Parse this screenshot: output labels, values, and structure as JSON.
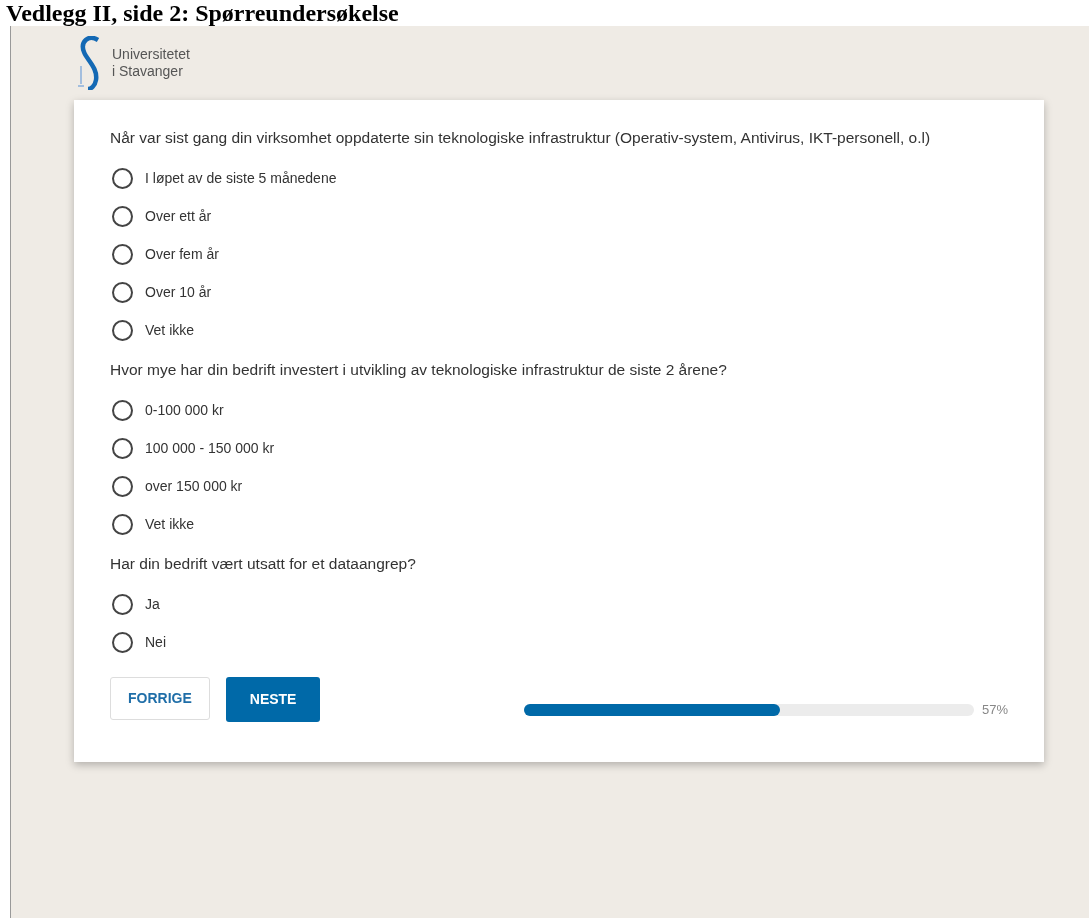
{
  "document_heading": "Vedlegg II, side 2: Spørreundersøkelse",
  "logo": {
    "lines": [
      "Universitetet",
      "i Stavanger"
    ]
  },
  "questions": [
    {
      "text": "Når var sist gang din virksomhet oppdaterte sin teknologiske infrastruktur (Operativ-system, Antivirus, IKT-personell, o.l)",
      "options": [
        {
          "label": "I løpet av de siste 5 månedene",
          "selected": false
        },
        {
          "label": "Over ett år",
          "selected": false
        },
        {
          "label": "Over fem år",
          "selected": false
        },
        {
          "label": "Over 10 år",
          "selected": false
        },
        {
          "label": "Vet ikke",
          "selected": false
        }
      ]
    },
    {
      "text": "Hvor mye har din bedrift investert i utvikling av teknologiske infrastruktur de siste 2 årene?",
      "options": [
        {
          "label": "0-100 000 kr",
          "selected": false
        },
        {
          "label": "100 000 - 150 000 kr",
          "selected": false
        },
        {
          "label": "over 150 000 kr",
          "selected": false
        },
        {
          "label": "Vet ikke",
          "selected": false
        }
      ]
    },
    {
      "text": "Har din bedrift vært utsatt for et dataangrep?",
      "options": [
        {
          "label": "Ja",
          "selected": false
        },
        {
          "label": "Nei",
          "selected": false
        }
      ]
    }
  ],
  "buttons": [
    {
      "label": "FORRIGE",
      "kind": "secondary"
    },
    {
      "label": "NESTE",
      "kind": "primary"
    }
  ],
  "progress": {
    "level": 0.57,
    "reading": "57%"
  }
}
